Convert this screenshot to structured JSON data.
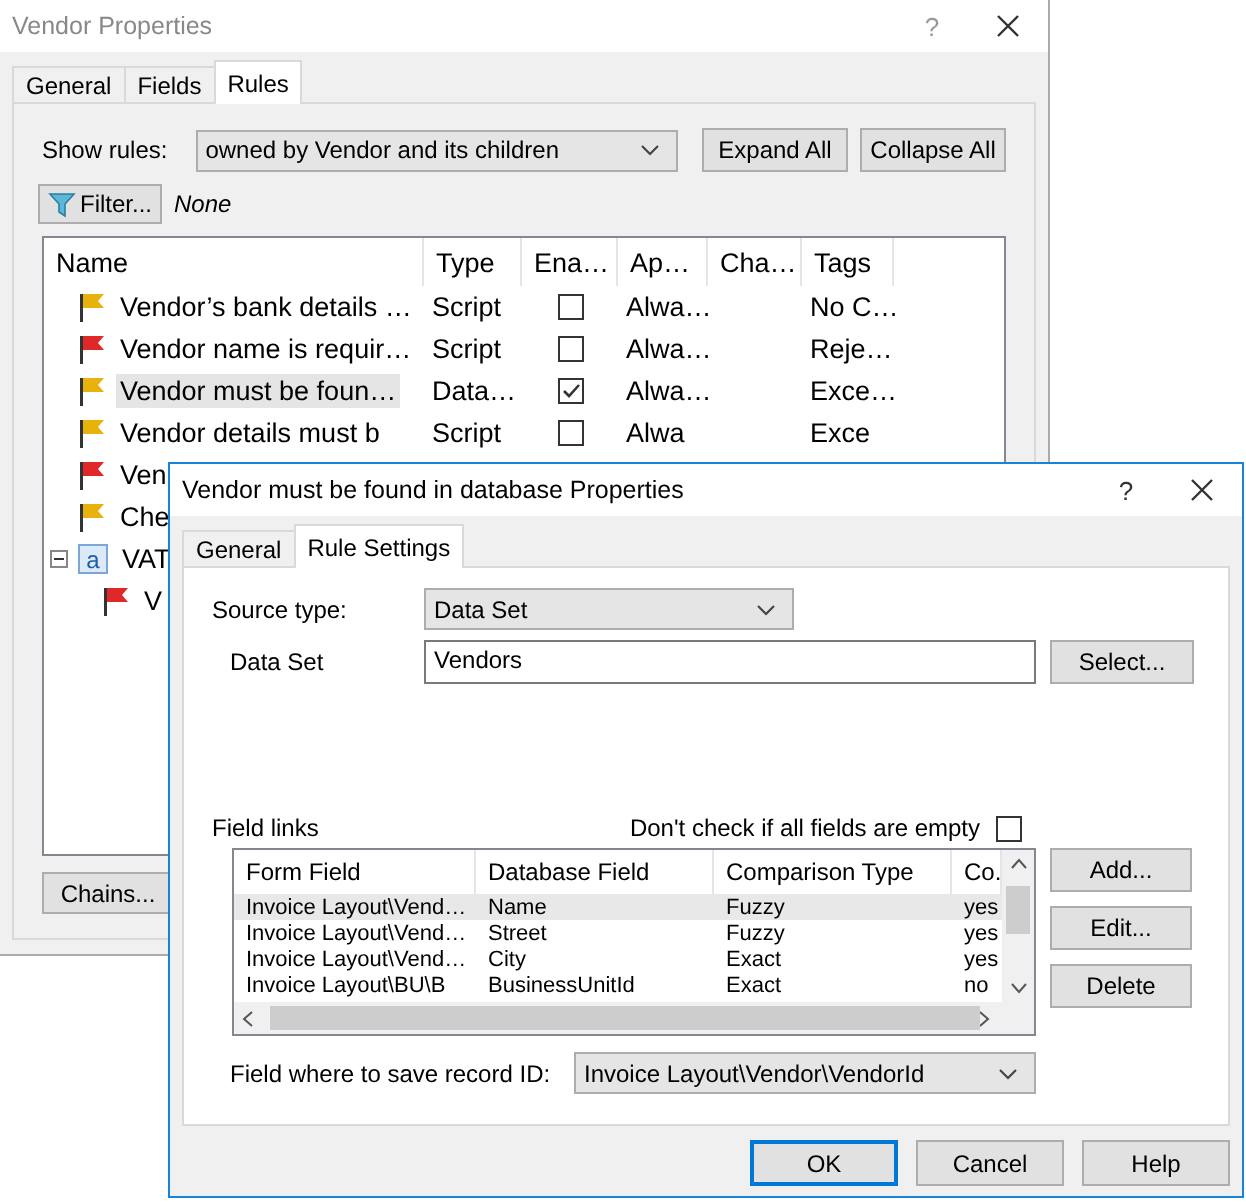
{
  "back_window": {
    "title": "Vendor Properties",
    "help": "?",
    "tabs": [
      {
        "label": "General",
        "selected": false
      },
      {
        "label": "Fields",
        "selected": false
      },
      {
        "label": "Rules",
        "selected": true
      }
    ],
    "show_rules": {
      "label": "Show rules:",
      "value": "owned by Vendor and its children"
    },
    "top_buttons": [
      "Expand All",
      "Collapse All"
    ],
    "filter": {
      "button": "Filter...",
      "value": "None"
    },
    "rules_table": {
      "columns": [
        "Name",
        "Type",
        "Ena…",
        "Ap…",
        "Cha…",
        "Tags"
      ],
      "rows": [
        {
          "kind": "rule",
          "color": "#e8b20c",
          "name": "Vendor’s bank details …",
          "type": "Script",
          "enabled": false,
          "applies": "Alwa…",
          "tags": "No C…",
          "selected": false
        },
        {
          "kind": "rule",
          "color": "#e02828",
          "name": "Vendor name is requir…",
          "type": "Script",
          "enabled": false,
          "applies": "Alwa…",
          "tags": "Reje…",
          "selected": false
        },
        {
          "kind": "rule",
          "color": "#e8b20c",
          "name": "Vendor must be foun…",
          "type": "Data…",
          "enabled": true,
          "applies": "Alwa…",
          "tags": "Exce…",
          "selected": true
        },
        {
          "kind": "rule",
          "color": "#e8b20c",
          "name": "Vendor details must b",
          "type": "Script",
          "enabled": false,
          "applies": "Alwa",
          "tags": "Exce",
          "selected": false
        },
        {
          "kind": "rule",
          "color": "#e02828",
          "name": "Ven",
          "selected": false
        },
        {
          "kind": "rule",
          "color": "#e8b20c",
          "name": "Che",
          "selected": false
        },
        {
          "kind": "group",
          "glyph": "a",
          "name": "VAT",
          "expanded": true,
          "selected": false,
          "children": [
            {
              "kind": "rule",
              "color": "#e02828",
              "name": "V",
              "selected": false
            }
          ]
        }
      ]
    },
    "chains_button": "Chains..."
  },
  "dialog": {
    "title": "Vendor must be found in database Properties",
    "help": "?",
    "tabs": [
      {
        "label": "General",
        "selected": false
      },
      {
        "label": "Rule Settings",
        "selected": true
      }
    ],
    "source_type": {
      "label": "Source type:",
      "value": "Data Set"
    },
    "data_set": {
      "label": "Data Set",
      "value": "Vendors",
      "button": "Select..."
    },
    "field_links": {
      "label": "Field links",
      "dont_check": {
        "label": "Don't check if all fields are empty",
        "checked": false
      },
      "columns": [
        "Form Field",
        "Database Field",
        "Comparison Type",
        "Co."
      ],
      "rows": [
        {
          "cells": [
            "Invoice Layout\\Vend…",
            "Name",
            "Fuzzy",
            "yes"
          ],
          "selected": true
        },
        {
          "cells": [
            "Invoice Layout\\Vend…",
            "Street",
            "Fuzzy",
            "yes"
          ],
          "selected": false
        },
        {
          "cells": [
            "Invoice Layout\\Vend…",
            "City",
            "Exact",
            "yes"
          ],
          "selected": false
        },
        {
          "cells": [
            "Invoice Layout\\BU\\B",
            "BusinessUnitId",
            "Exact",
            "no"
          ],
          "selected": false
        }
      ],
      "buttons": [
        "Add...",
        "Edit...",
        "Delete"
      ]
    },
    "record_id": {
      "label": "Field where to save record ID:",
      "value": "Invoice Layout\\Vendor\\VendorId"
    },
    "buttons": [
      {
        "label": "OK",
        "default": true
      },
      {
        "label": "Cancel",
        "default": false
      },
      {
        "label": "Help",
        "default": false
      }
    ]
  }
}
